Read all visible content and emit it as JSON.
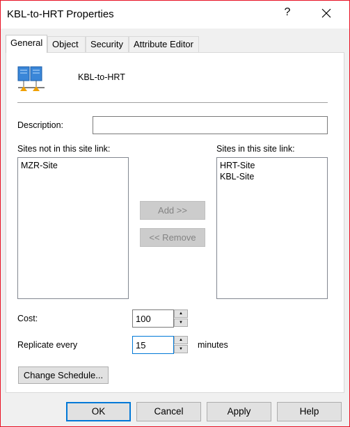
{
  "window": {
    "title": "KBL-to-HRT Properties",
    "help_glyph": "?",
    "close_glyph": "close"
  },
  "tabs": [
    {
      "label": "General",
      "active": true
    },
    {
      "label": "Object"
    },
    {
      "label": "Security"
    },
    {
      "label": "Attribute Editor"
    }
  ],
  "general": {
    "object_name": "KBL-to-HRT",
    "icon": "site-link-icon",
    "description": {
      "label": "Description:",
      "value": ""
    },
    "sites_not_in": {
      "label": "Sites not in this site link:",
      "items": [
        "MZR-Site"
      ]
    },
    "sites_in": {
      "label": "Sites in this site link:",
      "items": [
        "HRT-Site",
        "KBL-Site"
      ]
    },
    "add_button": "Add >>",
    "remove_button": "<< Remove",
    "cost": {
      "label": "Cost:",
      "value": "100"
    },
    "replicate": {
      "label": "Replicate every",
      "value": "15",
      "unit": "minutes"
    },
    "change_schedule_button": "Change Schedule..."
  },
  "footer": {
    "ok": "OK",
    "cancel": "Cancel",
    "apply": "Apply",
    "help": "Help"
  }
}
